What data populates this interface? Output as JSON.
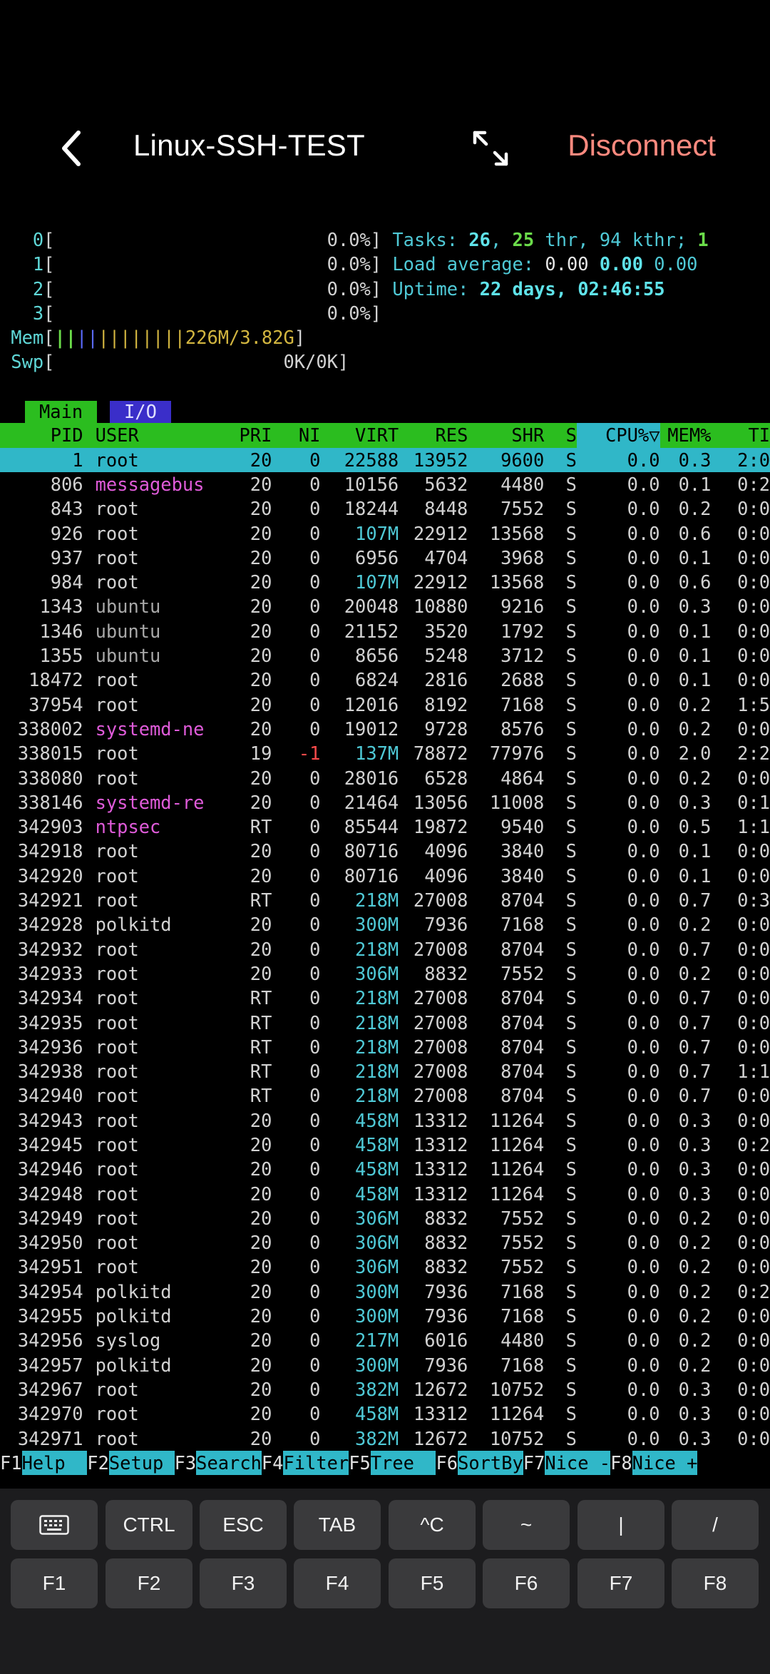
{
  "header": {
    "title": "Linux-SSH-TEST",
    "disconnect_label": "Disconnect"
  },
  "meters": {
    "cpus": [
      {
        "id": "0",
        "value": "0.0%"
      },
      {
        "id": "1",
        "value": "0.0%"
      },
      {
        "id": "2",
        "value": "0.0%"
      },
      {
        "id": "3",
        "value": "0.0%"
      }
    ],
    "mem_label": "Mem",
    "mem_value": "226M/3.82G",
    "swp_label": "Swp",
    "swp_value": "0K/0K",
    "tasks_label": "Tasks: ",
    "tasks_count": "26",
    "thr_count": "25",
    "thr_text": " thr, 94 kthr; ",
    "running": "1",
    "load_label": "Load average: ",
    "load1": "0.00",
    "load5": "0.00",
    "load15": "0.00",
    "uptime_label": "Uptime: ",
    "uptime_value": "22 days, 02:46:55"
  },
  "tabs": {
    "main": "Main",
    "io": "I/O"
  },
  "columns": {
    "pid": "PID",
    "user": "USER",
    "pri": "PRI",
    "ni": "NI",
    "virt": "VIRT",
    "res": "RES",
    "shr": "SHR",
    "s": "S",
    "cpu": "CPU%▽",
    "mem": "MEM%",
    "time": "TI"
  },
  "processes": [
    {
      "pid": "1",
      "user": "root",
      "pri": "20",
      "ni": "0",
      "virt": "22588",
      "res": "13952",
      "shr": "9600",
      "s": "S",
      "cpu": "0.0",
      "mem": "0.3",
      "time": "2:0",
      "selected": true
    },
    {
      "pid": "806",
      "user": "messagebus",
      "pri": "20",
      "ni": "0",
      "virt": "10156",
      "res": "5632",
      "shr": "4480",
      "s": "S",
      "cpu": "0.0",
      "mem": "0.1",
      "time": "0:2",
      "ucolor": "magenta"
    },
    {
      "pid": "843",
      "user": "root",
      "pri": "20",
      "ni": "0",
      "virt": "18244",
      "res": "8448",
      "shr": "7552",
      "s": "S",
      "cpu": "0.0",
      "mem": "0.2",
      "time": "0:0"
    },
    {
      "pid": "926",
      "user": "root",
      "pri": "20",
      "ni": "0",
      "virt": "107M",
      "res": "22912",
      "shr": "13568",
      "s": "S",
      "cpu": "0.0",
      "mem": "0.6",
      "time": "0:0"
    },
    {
      "pid": "937",
      "user": "root",
      "pri": "20",
      "ni": "0",
      "virt": "6956",
      "res": "4704",
      "shr": "3968",
      "s": "S",
      "cpu": "0.0",
      "mem": "0.1",
      "time": "0:0"
    },
    {
      "pid": "984",
      "user": "root",
      "pri": "20",
      "ni": "0",
      "virt": "107M",
      "res": "22912",
      "shr": "13568",
      "s": "S",
      "cpu": "0.0",
      "mem": "0.6",
      "time": "0:0"
    },
    {
      "pid": "1343",
      "user": "ubuntu",
      "pri": "20",
      "ni": "0",
      "virt": "20048",
      "res": "10880",
      "shr": "9216",
      "s": "S",
      "cpu": "0.0",
      "mem": "0.3",
      "time": "0:0",
      "ucolor": "dim"
    },
    {
      "pid": "1346",
      "user": "ubuntu",
      "pri": "20",
      "ni": "0",
      "virt": "21152",
      "res": "3520",
      "shr": "1792",
      "s": "S",
      "cpu": "0.0",
      "mem": "0.1",
      "time": "0:0",
      "ucolor": "dim"
    },
    {
      "pid": "1355",
      "user": "ubuntu",
      "pri": "20",
      "ni": "0",
      "virt": "8656",
      "res": "5248",
      "shr": "3712",
      "s": "S",
      "cpu": "0.0",
      "mem": "0.1",
      "time": "0:0",
      "ucolor": "dim"
    },
    {
      "pid": "18472",
      "user": "root",
      "pri": "20",
      "ni": "0",
      "virt": "6824",
      "res": "2816",
      "shr": "2688",
      "s": "S",
      "cpu": "0.0",
      "mem": "0.1",
      "time": "0:0"
    },
    {
      "pid": "37954",
      "user": "root",
      "pri": "20",
      "ni": "0",
      "virt": "12016",
      "res": "8192",
      "shr": "7168",
      "s": "S",
      "cpu": "0.0",
      "mem": "0.2",
      "time": "1:5"
    },
    {
      "pid": "338002",
      "user": "systemd-ne",
      "pri": "20",
      "ni": "0",
      "virt": "19012",
      "res": "9728",
      "shr": "8576",
      "s": "S",
      "cpu": "0.0",
      "mem": "0.2",
      "time": "0:0",
      "ucolor": "magenta"
    },
    {
      "pid": "338015",
      "user": "root",
      "pri": "19",
      "ni": "-1",
      "virt": "137M",
      "res": "78872",
      "shr": "77976",
      "s": "S",
      "cpu": "0.0",
      "mem": "2.0",
      "time": "2:2",
      "nicolor": "red"
    },
    {
      "pid": "338080",
      "user": "root",
      "pri": "20",
      "ni": "0",
      "virt": "28016",
      "res": "6528",
      "shr": "4864",
      "s": "S",
      "cpu": "0.0",
      "mem": "0.2",
      "time": "0:0"
    },
    {
      "pid": "338146",
      "user": "systemd-re",
      "pri": "20",
      "ni": "0",
      "virt": "21464",
      "res": "13056",
      "shr": "11008",
      "s": "S",
      "cpu": "0.0",
      "mem": "0.3",
      "time": "0:1",
      "ucolor": "magenta"
    },
    {
      "pid": "342903",
      "user": "ntpsec",
      "pri": "RT",
      "ni": "0",
      "virt": "85544",
      "res": "19872",
      "shr": "9540",
      "s": "S",
      "cpu": "0.0",
      "mem": "0.5",
      "time": "1:1",
      "ucolor": "magenta"
    },
    {
      "pid": "342918",
      "user": "root",
      "pri": "20",
      "ni": "0",
      "virt": "80716",
      "res": "4096",
      "shr": "3840",
      "s": "S",
      "cpu": "0.0",
      "mem": "0.1",
      "time": "0:0"
    },
    {
      "pid": "342920",
      "user": "root",
      "pri": "20",
      "ni": "0",
      "virt": "80716",
      "res": "4096",
      "shr": "3840",
      "s": "S",
      "cpu": "0.0",
      "mem": "0.1",
      "time": "0:0"
    },
    {
      "pid": "342921",
      "user": "root",
      "pri": "RT",
      "ni": "0",
      "virt": "218M",
      "res": "27008",
      "shr": "8704",
      "s": "S",
      "cpu": "0.0",
      "mem": "0.7",
      "time": "0:3"
    },
    {
      "pid": "342928",
      "user": "polkitd",
      "pri": "20",
      "ni": "0",
      "virt": "300M",
      "res": "7936",
      "shr": "7168",
      "s": "S",
      "cpu": "0.0",
      "mem": "0.2",
      "time": "0:0"
    },
    {
      "pid": "342932",
      "user": "root",
      "pri": "20",
      "ni": "0",
      "virt": "218M",
      "res": "27008",
      "shr": "8704",
      "s": "S",
      "cpu": "0.0",
      "mem": "0.7",
      "time": "0:0"
    },
    {
      "pid": "342933",
      "user": "root",
      "pri": "20",
      "ni": "0",
      "virt": "306M",
      "res": "8832",
      "shr": "7552",
      "s": "S",
      "cpu": "0.0",
      "mem": "0.2",
      "time": "0:0"
    },
    {
      "pid": "342934",
      "user": "root",
      "pri": "RT",
      "ni": "0",
      "virt": "218M",
      "res": "27008",
      "shr": "8704",
      "s": "S",
      "cpu": "0.0",
      "mem": "0.7",
      "time": "0:0"
    },
    {
      "pid": "342935",
      "user": "root",
      "pri": "RT",
      "ni": "0",
      "virt": "218M",
      "res": "27008",
      "shr": "8704",
      "s": "S",
      "cpu": "0.0",
      "mem": "0.7",
      "time": "0:0"
    },
    {
      "pid": "342936",
      "user": "root",
      "pri": "RT",
      "ni": "0",
      "virt": "218M",
      "res": "27008",
      "shr": "8704",
      "s": "S",
      "cpu": "0.0",
      "mem": "0.7",
      "time": "0:0"
    },
    {
      "pid": "342938",
      "user": "root",
      "pri": "RT",
      "ni": "0",
      "virt": "218M",
      "res": "27008",
      "shr": "8704",
      "s": "S",
      "cpu": "0.0",
      "mem": "0.7",
      "time": "1:1"
    },
    {
      "pid": "342940",
      "user": "root",
      "pri": "RT",
      "ni": "0",
      "virt": "218M",
      "res": "27008",
      "shr": "8704",
      "s": "S",
      "cpu": "0.0",
      "mem": "0.7",
      "time": "0:0"
    },
    {
      "pid": "342943",
      "user": "root",
      "pri": "20",
      "ni": "0",
      "virt": "458M",
      "res": "13312",
      "shr": "11264",
      "s": "S",
      "cpu": "0.0",
      "mem": "0.3",
      "time": "0:0"
    },
    {
      "pid": "342945",
      "user": "root",
      "pri": "20",
      "ni": "0",
      "virt": "458M",
      "res": "13312",
      "shr": "11264",
      "s": "S",
      "cpu": "0.0",
      "mem": "0.3",
      "time": "0:2"
    },
    {
      "pid": "342946",
      "user": "root",
      "pri": "20",
      "ni": "0",
      "virt": "458M",
      "res": "13312",
      "shr": "11264",
      "s": "S",
      "cpu": "0.0",
      "mem": "0.3",
      "time": "0:0"
    },
    {
      "pid": "342948",
      "user": "root",
      "pri": "20",
      "ni": "0",
      "virt": "458M",
      "res": "13312",
      "shr": "11264",
      "s": "S",
      "cpu": "0.0",
      "mem": "0.3",
      "time": "0:0"
    },
    {
      "pid": "342949",
      "user": "root",
      "pri": "20",
      "ni": "0",
      "virt": "306M",
      "res": "8832",
      "shr": "7552",
      "s": "S",
      "cpu": "0.0",
      "mem": "0.2",
      "time": "0:0"
    },
    {
      "pid": "342950",
      "user": "root",
      "pri": "20",
      "ni": "0",
      "virt": "306M",
      "res": "8832",
      "shr": "7552",
      "s": "S",
      "cpu": "0.0",
      "mem": "0.2",
      "time": "0:0"
    },
    {
      "pid": "342951",
      "user": "root",
      "pri": "20",
      "ni": "0",
      "virt": "306M",
      "res": "8832",
      "shr": "7552",
      "s": "S",
      "cpu": "0.0",
      "mem": "0.2",
      "time": "0:0"
    },
    {
      "pid": "342954",
      "user": "polkitd",
      "pri": "20",
      "ni": "0",
      "virt": "300M",
      "res": "7936",
      "shr": "7168",
      "s": "S",
      "cpu": "0.0",
      "mem": "0.2",
      "time": "0:2"
    },
    {
      "pid": "342955",
      "user": "polkitd",
      "pri": "20",
      "ni": "0",
      "virt": "300M",
      "res": "7936",
      "shr": "7168",
      "s": "S",
      "cpu": "0.0",
      "mem": "0.2",
      "time": "0:0"
    },
    {
      "pid": "342956",
      "user": "syslog",
      "pri": "20",
      "ni": "0",
      "virt": "217M",
      "res": "6016",
      "shr": "4480",
      "s": "S",
      "cpu": "0.0",
      "mem": "0.2",
      "time": "0:0"
    },
    {
      "pid": "342957",
      "user": "polkitd",
      "pri": "20",
      "ni": "0",
      "virt": "300M",
      "res": "7936",
      "shr": "7168",
      "s": "S",
      "cpu": "0.0",
      "mem": "0.2",
      "time": "0:0"
    },
    {
      "pid": "342967",
      "user": "root",
      "pri": "20",
      "ni": "0",
      "virt": "382M",
      "res": "12672",
      "shr": "10752",
      "s": "S",
      "cpu": "0.0",
      "mem": "0.3",
      "time": "0:0"
    },
    {
      "pid": "342970",
      "user": "root",
      "pri": "20",
      "ni": "0",
      "virt": "458M",
      "res": "13312",
      "shr": "11264",
      "s": "S",
      "cpu": "0.0",
      "mem": "0.3",
      "time": "0:0"
    },
    {
      "pid": "342971",
      "user": "root",
      "pri": "20",
      "ni": "0",
      "virt": "382M",
      "res": "12672",
      "shr": "10752",
      "s": "S",
      "cpu": "0.0",
      "mem": "0.3",
      "time": "0:0"
    }
  ],
  "function_bar": [
    {
      "key": "F1",
      "label": "Help  "
    },
    {
      "key": "F2",
      "label": "Setup "
    },
    {
      "key": "F3",
      "label": "Search"
    },
    {
      "key": "F4",
      "label": "Filter"
    },
    {
      "key": "F5",
      "label": "Tree  "
    },
    {
      "key": "F6",
      "label": "SortBy"
    },
    {
      "key": "F7",
      "label": "Nice -"
    },
    {
      "key": "F8",
      "label": "Nice +"
    }
  ],
  "keyboard": {
    "row1": [
      "",
      "CTRL",
      "ESC",
      "TAB",
      "^C",
      "~",
      "|",
      "/"
    ],
    "row2": [
      "F1",
      "F2",
      "F3",
      "F4",
      "F5",
      "F6",
      "F7",
      "F8"
    ]
  },
  "colors": {
    "header_green": "#2bbd1f",
    "sorted_cyan": "#30b7c8",
    "io_tab_blue": "#3a2ec9",
    "disconnect": "#ff8a7f"
  }
}
